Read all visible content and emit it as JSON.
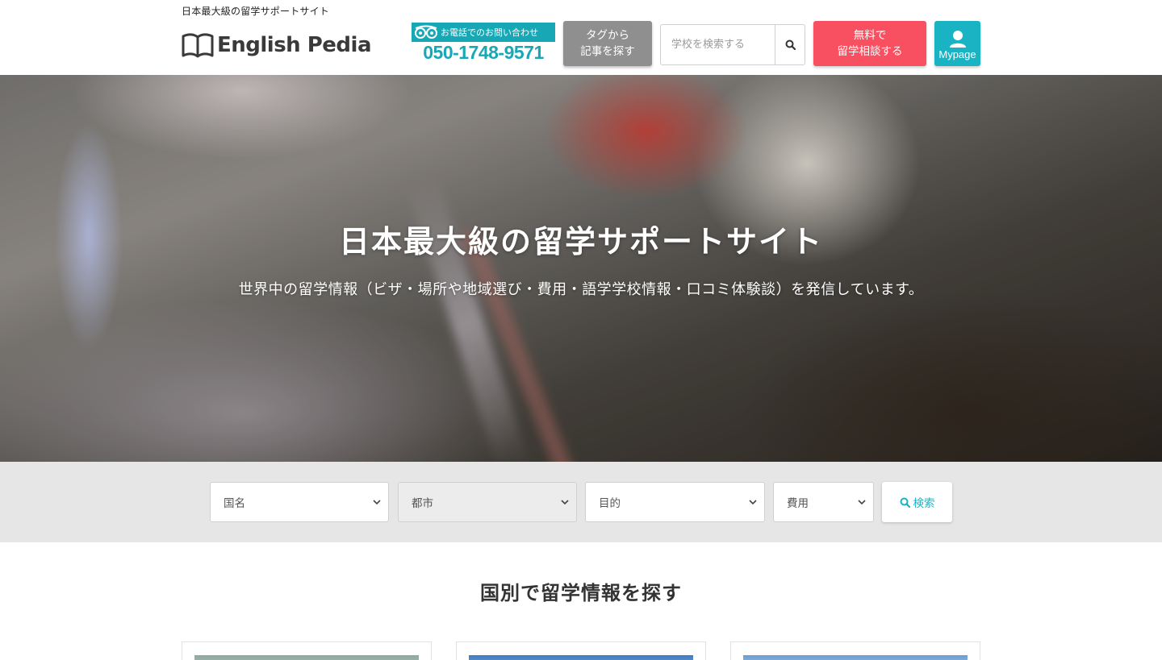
{
  "header": {
    "tagline": "日本最大級の留学サポートサイト",
    "logo_text": "English Pedia",
    "phone": {
      "label": "お電話でのお問い合わせ",
      "number": "050-1748-9571"
    },
    "tag_button": {
      "line1": "タグから",
      "line2": "記事を探す"
    },
    "search": {
      "placeholder": "学校を検索する"
    },
    "consult_button": {
      "line1": "無料で",
      "line2": "留学相談する"
    },
    "mypage_label": "Mypage"
  },
  "hero": {
    "title": "日本最大級の留学サポートサイト",
    "subtitle": "世界中の留学情報（ビザ・場所や地域選び・費用・語学学校情報・口コミ体験談）を発信しています。"
  },
  "filters": {
    "country": "国名",
    "city": "都市",
    "purpose": "目的",
    "cost": "費用",
    "search_label": "検索"
  },
  "section": {
    "title": "国別で留学情報を探す"
  },
  "colors": {
    "brand": "#19b3c4",
    "consult": "#f85060",
    "tag_button": "#8f8f8f",
    "phone": "#18a7b5"
  },
  "icons": [
    "book-logo-icon",
    "free-dial-icon",
    "search-icon",
    "user-icon",
    "chevron-down-icon"
  ]
}
